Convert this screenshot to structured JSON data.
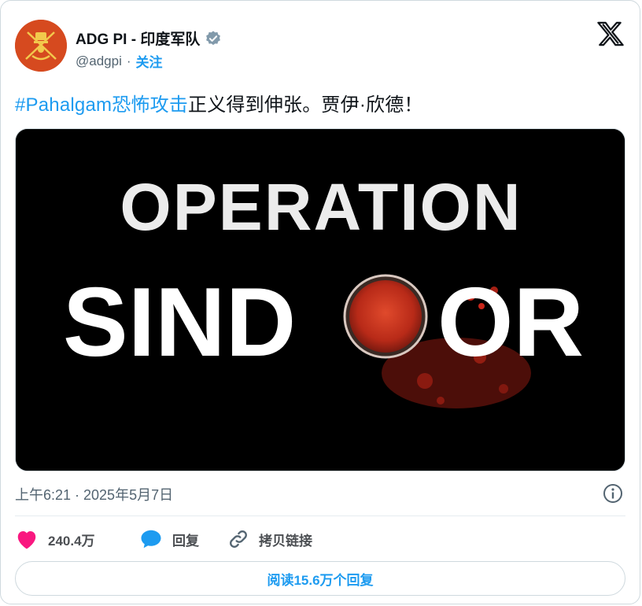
{
  "author": {
    "display_name": "ADG PI - 印度军队",
    "handle": "@adgpi",
    "separator": "·",
    "follow_label": "关注"
  },
  "tweet": {
    "hashtag": "#Pahalgam恐怖攻击",
    "text": "正义得到伸张。贾伊·欣德！",
    "image_title_top": "OPERATION",
    "image_title_left": "SIND",
    "image_title_right": "OR"
  },
  "meta": {
    "timestamp": "上午6:21 · 2025年5月7日"
  },
  "actions": {
    "likes_count": "240.4万",
    "reply_label": "回复",
    "copy_link_label": "拷贝链接"
  },
  "footer": {
    "read_replies_label": "阅读15.6万个回复"
  },
  "colors": {
    "accent": "#1d9bf0",
    "like": "#f91880",
    "verified": "#829aab",
    "avatar_bg": "#d64a1f",
    "sindoor_red": "#c8261a"
  },
  "icons": [
    "army-emblem-icon",
    "verified-badge-icon",
    "x-logo-icon",
    "info-icon",
    "heart-icon",
    "reply-bubble-icon",
    "link-icon"
  ]
}
